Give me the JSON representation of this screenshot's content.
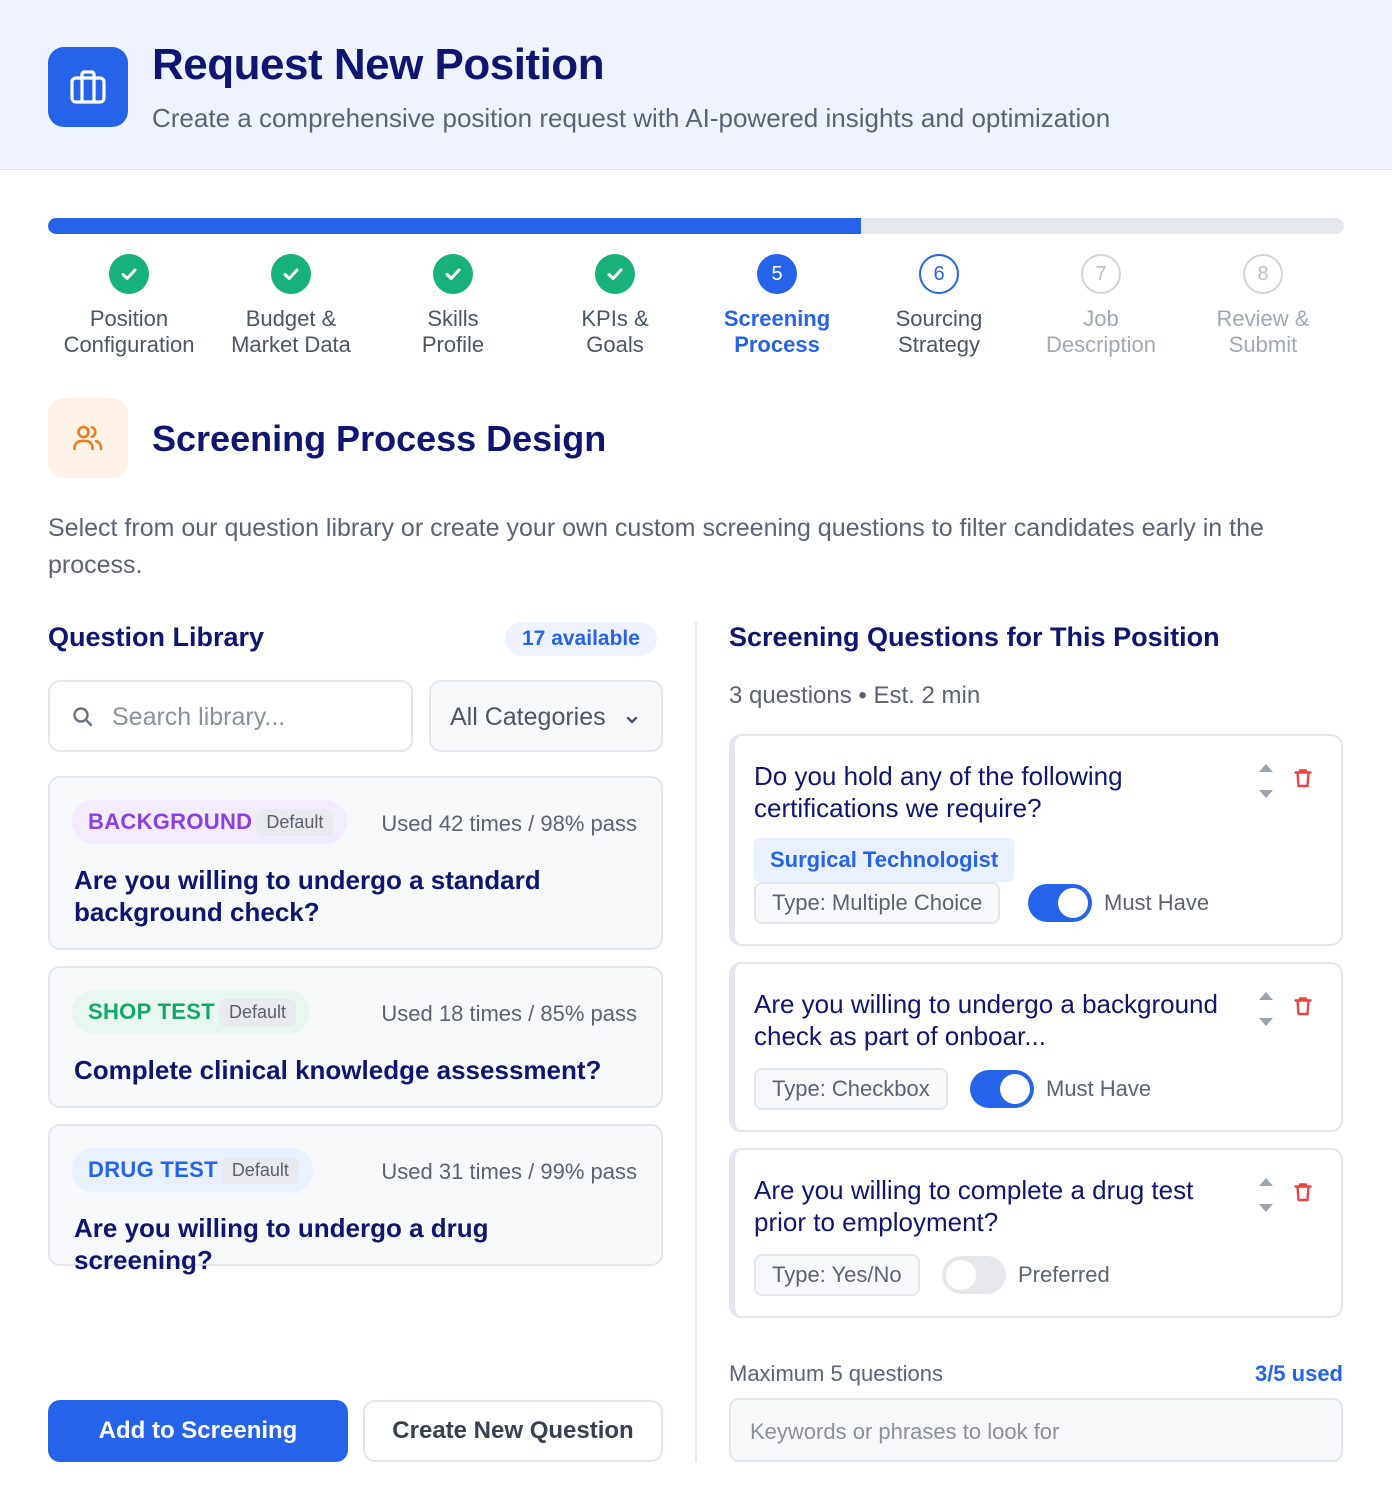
{
  "header": {
    "title": "Request New Position",
    "subtitle": "Create a comprehensive position request with AI-powered insights and optimization",
    "icon": "briefcase-icon"
  },
  "progress": {
    "fraction": 0.627
  },
  "steps": [
    {
      "number": "1",
      "line1": "Position",
      "line2": "Configuration",
      "state": "done"
    },
    {
      "number": "2",
      "line1": "Budget &",
      "line2": "Market Data",
      "state": "done"
    },
    {
      "number": "3",
      "line1": "Skills",
      "line2": "Profile",
      "state": "done"
    },
    {
      "number": "4",
      "line1": "KPIs &",
      "line2": "Goals",
      "state": "done"
    },
    {
      "number": "5",
      "line1": "Screening",
      "line2": "Process",
      "state": "active"
    },
    {
      "number": "6",
      "line1": "Sourcing",
      "line2": "Strategy",
      "state": "next"
    },
    {
      "number": "7",
      "line1": "Job",
      "line2": "Description",
      "state": "future"
    },
    {
      "number": "8",
      "line1": "Review &",
      "line2": "Submit",
      "state": "future"
    }
  ],
  "section": {
    "title": "Screening Process Design",
    "description": "Select from our question library or create your own custom screening questions to filter candidates early in the process.",
    "icon": "users-icon"
  },
  "library": {
    "title": "Question Library",
    "count": "17 available",
    "search_placeholder": "Search library...",
    "category_selected": "All Categories",
    "cards": [
      {
        "category": "BACKGROUND",
        "default": "Default",
        "used": "Used 42 times / 98% pass",
        "question": "Are you willing to undergo a standard background check?",
        "color": "#8b3fe0",
        "bg": "#f3ecff"
      },
      {
        "category": "SHOP TEST",
        "default": "Default",
        "used": "Used 18 times / 85% pass",
        "question": "Complete clinical knowledge assessment?",
        "color": "#12a86a",
        "bg": "#e8f8f0"
      },
      {
        "category": "DRUG TEST",
        "default": "Default",
        "used": "Used 31 times / 99% pass",
        "question": "Are you willing to undergo a drug screening?",
        "color": "#2563eb",
        "bg": "#e9f0ff"
      }
    ],
    "add_button": "Add to Screening",
    "create_button": "Create New Question"
  },
  "screening": {
    "title": "Screening Questions for This Position",
    "meta": "3 questions • Est. 2 min",
    "questions": [
      {
        "text": "Do you hold any of the following certifications we require?",
        "chip": "Surgical Technologist",
        "type": "Type: Multiple Choice",
        "toggle_on": true,
        "toggle_label": "Must Have"
      },
      {
        "text": "Are you willing to undergo a background check as part of onboar...",
        "type": "Type: Checkbox",
        "toggle_on": true,
        "toggle_label": "Must Have"
      },
      {
        "text": "Are you willing to complete a drug test prior to employment?",
        "type": "Type: Yes/No",
        "toggle_on": false,
        "toggle_label": "Preferred"
      }
    ],
    "max_label": "Maximum 5 questions",
    "used_label": "3/5 used",
    "keywords_placeholder": "Keywords or phrases to look for"
  }
}
